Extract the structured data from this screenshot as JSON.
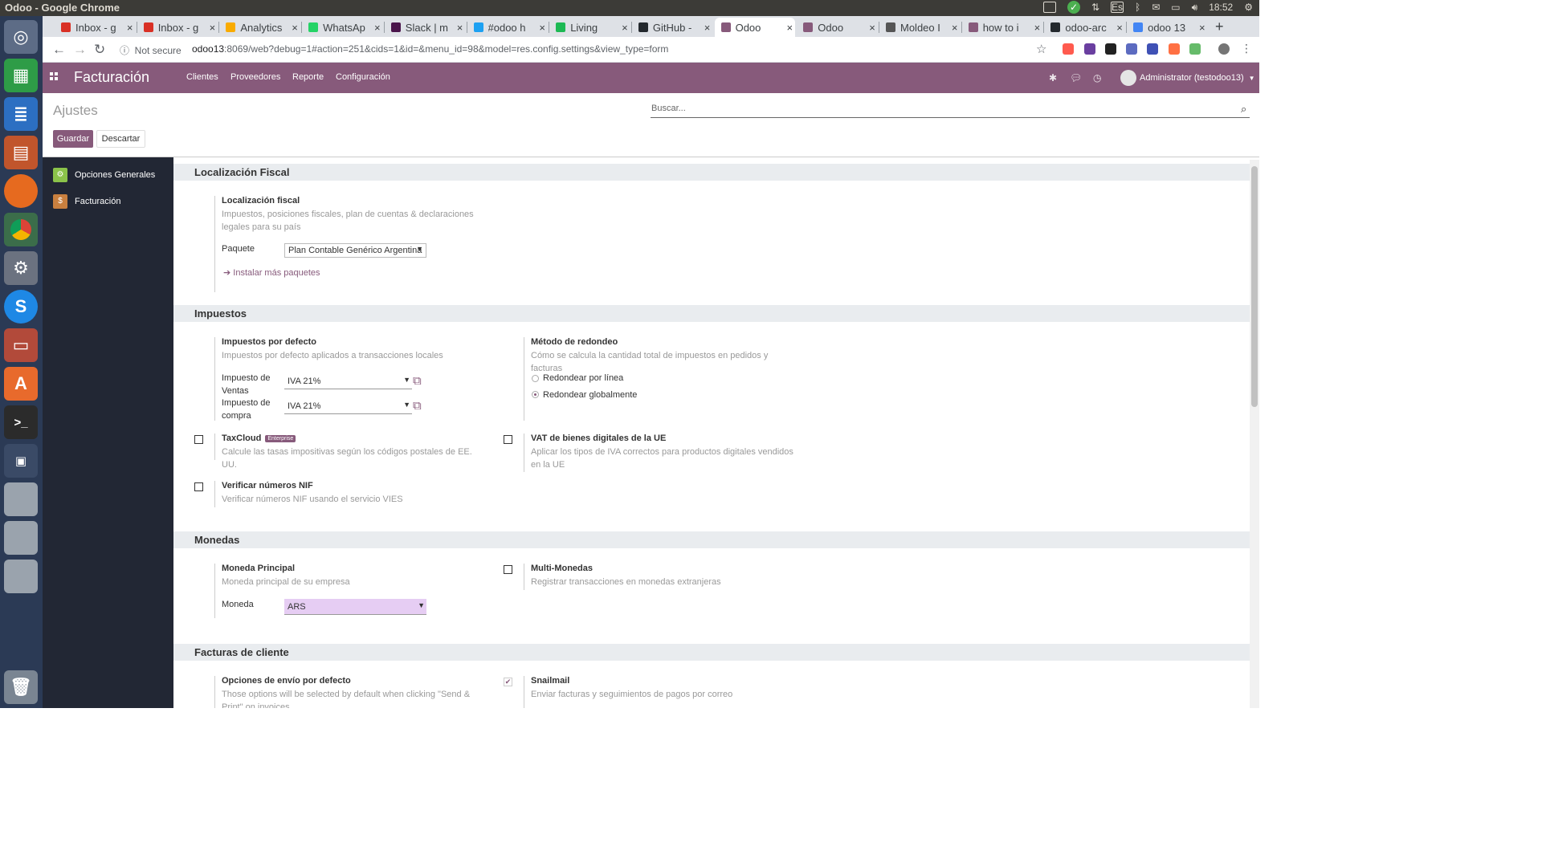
{
  "os": {
    "window_title": "Odoo - Google Chrome",
    "keyboard_layout": "Es",
    "time": "18:52"
  },
  "browser": {
    "tabs": [
      {
        "label": "Inbox - g",
        "icon": "gmail-icon",
        "color": "#d93025"
      },
      {
        "label": "Inbox - g",
        "icon": "gmail-icon",
        "color": "#d93025"
      },
      {
        "label": "Analytics",
        "icon": "analytics-icon",
        "color": "#f9ab00"
      },
      {
        "label": "WhatsAp",
        "icon": "whatsapp-icon",
        "color": "#25d366"
      },
      {
        "label": "Slack | m",
        "icon": "slack-icon",
        "color": "#4a154b"
      },
      {
        "label": "#odoo h",
        "icon": "twitter-icon",
        "color": "#1da1f2"
      },
      {
        "label": "Living",
        "icon": "spotify-icon",
        "color": "#1db954"
      },
      {
        "label": "GitHub -",
        "icon": "github-icon",
        "color": "#24292e"
      },
      {
        "label": "Odoo",
        "icon": "odoo-icon",
        "color": "#875a7b",
        "active": true
      },
      {
        "label": "Odoo",
        "icon": "odoo-icon",
        "color": "#875a7b"
      },
      {
        "label": "Moldeo I",
        "icon": "moldeo-icon",
        "color": "#555555"
      },
      {
        "label": "how to i",
        "icon": "odoo-icon",
        "color": "#875a7b"
      },
      {
        "label": "odoo-arc",
        "icon": "github-icon",
        "color": "#24292e"
      },
      {
        "label": "odoo 13",
        "icon": "google-icon",
        "color": "#4285f4"
      }
    ],
    "security": "Not secure",
    "url_host": "odoo13",
    "url_rest": ":8069/web?debug=1#action=251&cids=1&id=&menu_id=98&model=res.config.settings&view_type=form"
  },
  "odoo": {
    "app_name": "Facturación",
    "menu": [
      "Clientes",
      "Proveedores",
      "Reporte",
      "Configuración"
    ],
    "user": "Administrator (testodoo13)",
    "breadcrumb": "Ajustes",
    "search_placeholder": "Buscar...",
    "save_label": "Guardar",
    "discard_label": "Descartar",
    "sidebar": [
      {
        "label": "Opciones Generales",
        "icon": "gear-icon",
        "color": "#8bc34a"
      },
      {
        "label": "Facturación",
        "icon": "invoice-icon",
        "color": "#c9803f"
      }
    ]
  },
  "settings": {
    "fiscal": {
      "section": "Localización Fiscal",
      "title": "Localización fiscal",
      "desc": "Impuestos, posiciones fiscales, plan de cuentas & declaraciones legales para su país",
      "package_label": "Paquete",
      "package_value": "Plan Contable Genérico Argentina",
      "install_more": "Instalar más paquetes"
    },
    "taxes": {
      "section": "Impuestos",
      "default_title": "Impuestos por defecto",
      "default_desc": "Impuestos por defecto aplicados a transacciones locales",
      "sales_label": "Impuesto de Ventas",
      "sales_value": "IVA 21%",
      "purchase_label": "Impuesto de compra",
      "purchase_value": "IVA 21%",
      "rounding_title": "Método de redondeo",
      "rounding_desc": "Cómo se calcula la cantidad total de impuestos en pedidos y facturas",
      "rounding_options": [
        {
          "label": "Redondear por línea",
          "selected": false
        },
        {
          "label": "Redondear globalmente",
          "selected": true
        }
      ],
      "taxcloud_title": "TaxCloud",
      "taxcloud_badge": "Enterprise",
      "taxcloud_desc": "Calcule las tasas impositivas según los códigos postales de EE. UU.",
      "taxcloud_checked": false,
      "vat_eu_title": "VAT de bienes digitales de la UE",
      "vat_eu_desc": "Aplicar los tipos de IVA correctos para productos digitales vendidos en la UE",
      "vat_eu_checked": false,
      "nif_title": "Verificar números NIF",
      "nif_desc": "Verificar números NIF usando el servicio VIES",
      "nif_checked": false
    },
    "currencies": {
      "section": "Monedas",
      "main_title": "Moneda Principal",
      "main_desc": "Moneda principal de su empresa",
      "currency_label": "Moneda",
      "currency_value": "ARS",
      "multi_title": "Multi-Monedas",
      "multi_desc": "Registrar transacciones en monedas extranjeras",
      "multi_checked": false
    },
    "customer_invoices": {
      "section": "Facturas de cliente",
      "send_title": "Opciones de envío por defecto",
      "send_desc": "Those options will be selected by default when clicking \"Send & Print\" on invoices",
      "snailmail_title": "Snailmail",
      "snailmail_desc": "Enviar facturas y seguimientos de pagos por correo",
      "snailmail_checked": true
    }
  },
  "colors": {
    "brand": "#875a7b",
    "sidebar": "#222734",
    "launcher": "#2b3a55"
  }
}
